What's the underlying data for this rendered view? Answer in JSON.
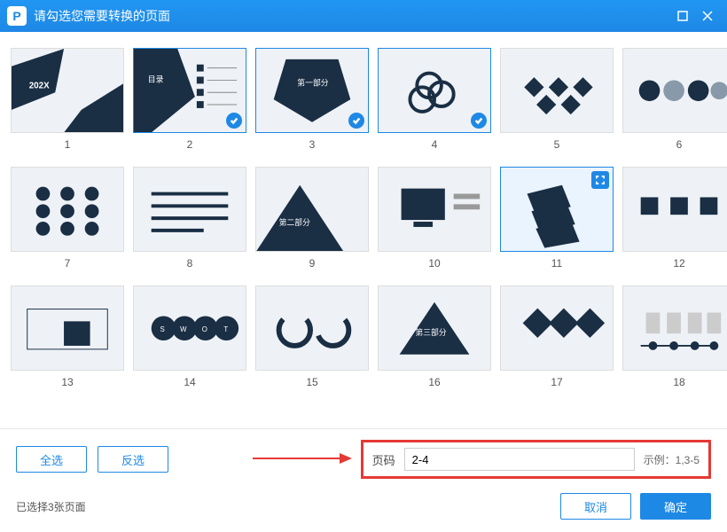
{
  "window": {
    "title": "请勾选您需要转换的页面",
    "logo_letter": "P"
  },
  "slides": [
    {
      "num": "1",
      "selected": false,
      "hover": false
    },
    {
      "num": "2",
      "selected": true,
      "hover": false,
      "label": "目录"
    },
    {
      "num": "3",
      "selected": true,
      "hover": false,
      "label": "第一部分"
    },
    {
      "num": "4",
      "selected": true,
      "hover": false
    },
    {
      "num": "5",
      "selected": false,
      "hover": false
    },
    {
      "num": "6",
      "selected": false,
      "hover": false
    },
    {
      "num": "7",
      "selected": false,
      "hover": false
    },
    {
      "num": "8",
      "selected": false,
      "hover": false
    },
    {
      "num": "9",
      "selected": false,
      "hover": false,
      "label": "第二部分"
    },
    {
      "num": "10",
      "selected": false,
      "hover": false
    },
    {
      "num": "11",
      "selected": false,
      "hover": true
    },
    {
      "num": "12",
      "selected": false,
      "hover": false
    },
    {
      "num": "13",
      "selected": false,
      "hover": false
    },
    {
      "num": "14",
      "selected": false,
      "hover": false
    },
    {
      "num": "15",
      "selected": false,
      "hover": false
    },
    {
      "num": "16",
      "selected": false,
      "hover": false,
      "label": "第三部分"
    },
    {
      "num": "17",
      "selected": false,
      "hover": false
    },
    {
      "num": "18",
      "selected": false,
      "hover": false
    }
  ],
  "controls": {
    "select_all": "全选",
    "invert": "反选",
    "page_label": "页码",
    "page_value": "2-4",
    "example": "示例：1,3-5"
  },
  "footer": {
    "status": "已选择3张页面",
    "cancel": "取消",
    "ok": "确定"
  },
  "colors": {
    "accent": "#1e88e5",
    "highlight_border": "#e53935",
    "dark": "#1a2e44"
  }
}
